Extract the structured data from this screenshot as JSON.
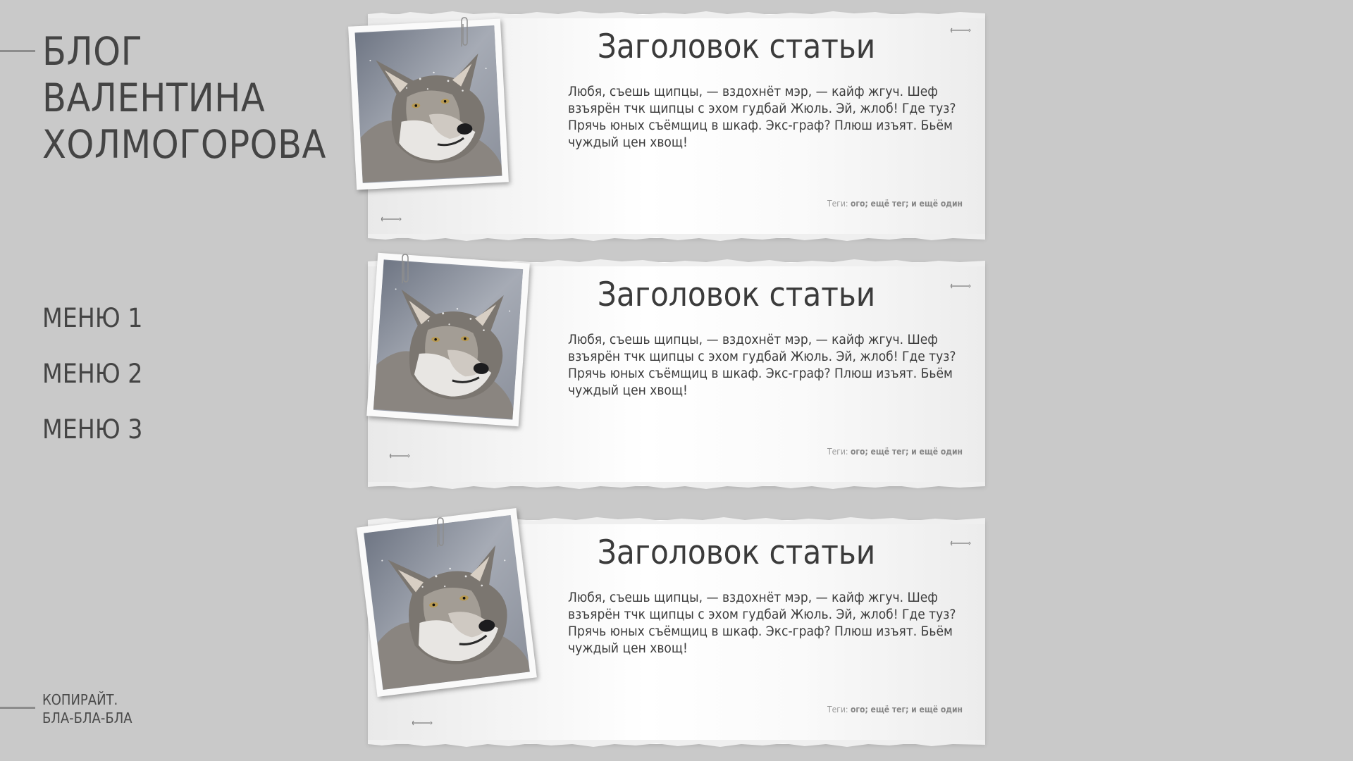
{
  "sidebar": {
    "title": "БЛОГ\nВАЛЕНТИНА\nХОЛМОГОРОВА",
    "menu": [
      {
        "label": "МЕНЮ 1"
      },
      {
        "label": "МЕНЮ 2"
      },
      {
        "label": "МЕНЮ 3"
      }
    ],
    "copyright": "КОПИРАЙТ.\nБЛА-БЛА-БЛА"
  },
  "posts": [
    {
      "title": "Заголовок статьи",
      "text": "Любя, съешь щипцы, — вздохнёт мэр, — кайф жгуч. Шеф взъярён тчк щипцы с эхом гудбай Жюль. Эй, жлоб! Где туз? Прячь юных съёмщиц в шкаф. Экс-граф? Плюш изъят. Бьём чуждый цен хвощ!",
      "tags_label": "Теги:",
      "tags": "ого; ещё тег; и ещё один",
      "photo_icon": "wolf-photo"
    },
    {
      "title": "Заголовок статьи",
      "text": "Любя, съешь щипцы, — вздохнёт мэр, — кайф жгуч. Шеф взъярён тчк щипцы с эхом гудбай Жюль. Эй, жлоб! Где туз? Прячь юных съёмщиц в шкаф. Экс-граф? Плюш изъят. Бьём чуждый цен хвощ!",
      "tags_label": "Теги:",
      "tags": "ого; ещё тег; и ещё один",
      "photo_icon": "wolf-photo"
    },
    {
      "title": "Заголовок статьи",
      "text": "Любя, съешь щипцы, — вздохнёт мэр, — кайф жгуч. Шеф взъярён тчк щипцы с эхом гудбай Жюль. Эй, жлоб! Где туз? Прячь юных съёмщиц в шкаф. Экс-граф? Плюш изъят. Бьём чуждый цен хвощ!",
      "tags_label": "Теги:",
      "tags": "ого; ещё тег; и ещё один",
      "photo_icon": "wolf-photo"
    }
  ],
  "colors": {
    "background": "#c9c9c9",
    "text": "#3f3f3f",
    "paper": "#ffffff"
  }
}
